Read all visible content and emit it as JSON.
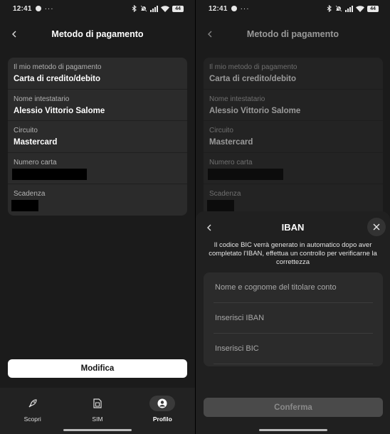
{
  "status": {
    "time": "12:41",
    "more": "···",
    "battery": "44"
  },
  "appbar": {
    "title": "Metodo di pagamento"
  },
  "details": [
    {
      "label": "Il mio metodo di pagamento",
      "value": "Carta di credito/debito"
    },
    {
      "label": "Nome intestatario",
      "value": "Alessio Vittorio Salome"
    },
    {
      "label": "Circuito",
      "value": "Mastercard"
    },
    {
      "label": "Numero carta",
      "value": null,
      "redacted": true
    },
    {
      "label": "Scadenza",
      "value": null,
      "redacted": true
    }
  ],
  "actions": {
    "edit_label": "Modifica"
  },
  "bottom_nav": [
    {
      "label": "Scopri",
      "icon": "rocket-icon",
      "active": false
    },
    {
      "label": "SIM",
      "icon": "sim-card-icon",
      "active": false
    },
    {
      "label": "Profilo",
      "icon": "profile-icon",
      "active": true
    }
  ],
  "iban_sheet": {
    "title": "IBAN",
    "description": "Il codice BIC verrà generato in automatico dopo aver completato l'IBAN, effettua un controllo per verificarne la correttezza",
    "fields": [
      {
        "placeholder": "Nome e cognome del titolare conto",
        "value": ""
      },
      {
        "placeholder": "Inserisci IBAN",
        "value": ""
      },
      {
        "placeholder": "Inserisci BIC",
        "value": ""
      }
    ],
    "confirm_label": "Conferma"
  },
  "colors": {
    "background": "#1b1b1b",
    "card": "#2b2b2b",
    "primary_button": "#ffffff",
    "disabled_button": "#4a4a4a"
  }
}
